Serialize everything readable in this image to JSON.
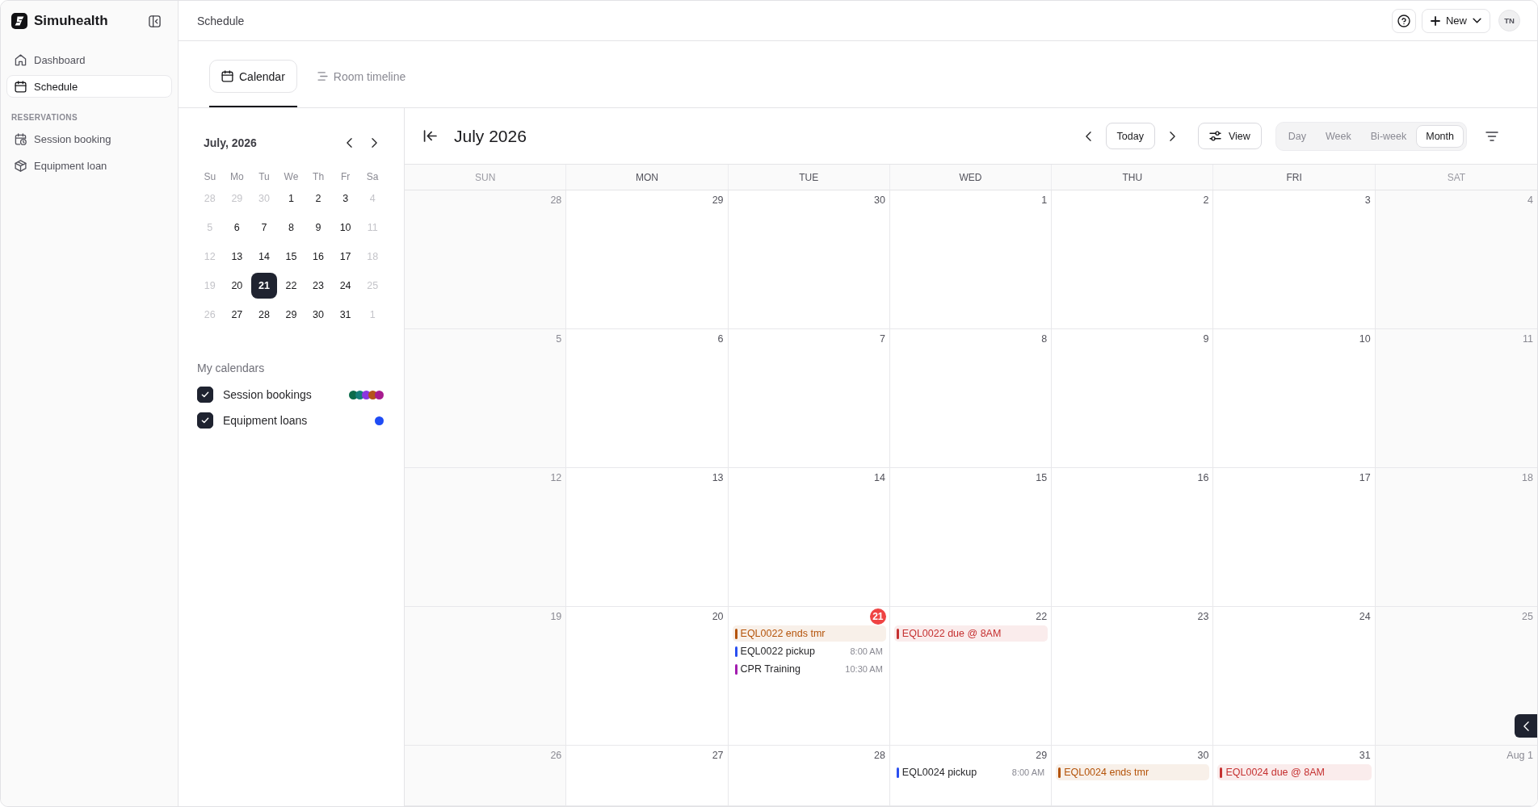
{
  "sidebar": {
    "brand": "Simuhealth",
    "nav": [
      {
        "label": "Dashboard",
        "selected": false
      },
      {
        "label": "Schedule",
        "selected": true
      }
    ],
    "section_label": "RESERVATIONS",
    "section_items": [
      {
        "label": "Session booking",
        "selected": false
      },
      {
        "label": "Equipment loan",
        "selected": false
      }
    ]
  },
  "topbar": {
    "title": "Schedule",
    "new_button": "New",
    "avatar": "TN"
  },
  "tabs": [
    {
      "label": "Calendar",
      "selected": true
    },
    {
      "label": "Room timeline",
      "selected": false
    }
  ],
  "mini_calendar": {
    "title": "July, 2026",
    "weekdays": [
      "Su",
      "Mo",
      "Tu",
      "We",
      "Th",
      "Fr",
      "Sa"
    ],
    "weeks": [
      [
        {
          "day": "28",
          "muted": true,
          "selected": false
        },
        {
          "day": "29",
          "muted": true,
          "selected": false
        },
        {
          "day": "30",
          "muted": true,
          "selected": false
        },
        {
          "day": "1",
          "muted": false,
          "selected": false
        },
        {
          "day": "2",
          "muted": false,
          "selected": false
        },
        {
          "day": "3",
          "muted": false,
          "selected": false
        },
        {
          "day": "4",
          "muted": true,
          "selected": false
        }
      ],
      [
        {
          "day": "5",
          "muted": true,
          "selected": false
        },
        {
          "day": "6",
          "muted": false,
          "selected": false
        },
        {
          "day": "7",
          "muted": false,
          "selected": false
        },
        {
          "day": "8",
          "muted": false,
          "selected": false
        },
        {
          "day": "9",
          "muted": false,
          "selected": false
        },
        {
          "day": "10",
          "muted": false,
          "selected": false
        },
        {
          "day": "11",
          "muted": true,
          "selected": false
        }
      ],
      [
        {
          "day": "12",
          "muted": true,
          "selected": false
        },
        {
          "day": "13",
          "muted": false,
          "selected": false
        },
        {
          "day": "14",
          "muted": false,
          "selected": false
        },
        {
          "day": "15",
          "muted": false,
          "selected": false
        },
        {
          "day": "16",
          "muted": false,
          "selected": false
        },
        {
          "day": "17",
          "muted": false,
          "selected": false
        },
        {
          "day": "18",
          "muted": true,
          "selected": false
        }
      ],
      [
        {
          "day": "19",
          "muted": true,
          "selected": false
        },
        {
          "day": "20",
          "muted": false,
          "selected": false
        },
        {
          "day": "21",
          "muted": false,
          "selected": true
        },
        {
          "day": "22",
          "muted": false,
          "selected": false
        },
        {
          "day": "23",
          "muted": false,
          "selected": false
        },
        {
          "day": "24",
          "muted": false,
          "selected": false
        },
        {
          "day": "25",
          "muted": true,
          "selected": false
        }
      ],
      [
        {
          "day": "26",
          "muted": true,
          "selected": false
        },
        {
          "day": "27",
          "muted": false,
          "selected": false
        },
        {
          "day": "28",
          "muted": false,
          "selected": false
        },
        {
          "day": "29",
          "muted": false,
          "selected": false
        },
        {
          "day": "30",
          "muted": false,
          "selected": false
        },
        {
          "day": "31",
          "muted": false,
          "selected": false
        },
        {
          "day": "1",
          "muted": true,
          "selected": false
        }
      ]
    ]
  },
  "my_calendars": {
    "title": "My calendars",
    "items": [
      {
        "label": "Session bookings",
        "checked": true,
        "dots": [
          {
            "color": "#0b6b4b"
          },
          {
            "color": "#137d78"
          },
          {
            "color": "#8b35e0"
          },
          {
            "color": "#b5531a"
          },
          {
            "color": "#a81b8f"
          }
        ]
      },
      {
        "label": "Equipment loans",
        "checked": true,
        "dots": [
          {
            "color": "#1f4cf5"
          }
        ]
      }
    ]
  },
  "calendar": {
    "title": "July 2026",
    "today_button": "Today",
    "view_button": "View",
    "view_modes": [
      {
        "label": "Day",
        "selected": false
      },
      {
        "label": "Week",
        "selected": false
      },
      {
        "label": "Bi-week",
        "selected": false
      },
      {
        "label": "Month",
        "selected": true
      }
    ],
    "weekdays": [
      {
        "label": "SUN",
        "weekend": true
      },
      {
        "label": "MON",
        "weekend": false
      },
      {
        "label": "TUE",
        "weekend": false
      },
      {
        "label": "WED",
        "weekend": false
      },
      {
        "label": "THU",
        "weekend": false
      },
      {
        "label": "FRI",
        "weekend": false
      },
      {
        "label": "SAT",
        "weekend": true
      }
    ],
    "weeks": [
      [
        {
          "day": "28",
          "today": false
        },
        {
          "day": "29",
          "today": false
        },
        {
          "day": "30",
          "today": false
        },
        {
          "day": "1",
          "today": false
        },
        {
          "day": "2",
          "today": false
        },
        {
          "day": "3",
          "today": false
        },
        {
          "day": "4",
          "today": false
        }
      ],
      [
        {
          "day": "5",
          "today": false
        },
        {
          "day": "6",
          "today": false
        },
        {
          "day": "7",
          "today": false
        },
        {
          "day": "8",
          "today": false
        },
        {
          "day": "9",
          "today": false
        },
        {
          "day": "10",
          "today": false
        },
        {
          "day": "11",
          "today": false
        }
      ],
      [
        {
          "day": "12",
          "today": false
        },
        {
          "day": "13",
          "today": false
        },
        {
          "day": "14",
          "today": false
        },
        {
          "day": "15",
          "today": false
        },
        {
          "day": "16",
          "today": false
        },
        {
          "day": "17",
          "today": false
        },
        {
          "day": "18",
          "today": false
        }
      ],
      [
        {
          "day": "19",
          "today": false
        },
        {
          "day": "20",
          "today": false
        },
        {
          "day": "21",
          "today": true,
          "events": [
            {
              "kind": "banner",
              "title": "EQL0022 ends tmr",
              "color": "#b45309"
            },
            {
              "kind": "timed",
              "title": "EQL0022 pickup",
              "time": "8:00 AM",
              "color": "#2a4ff0"
            },
            {
              "kind": "timed",
              "title": "CPR Training",
              "time": "10:30 AM",
              "color": "#a21caf"
            }
          ]
        },
        {
          "day": "22",
          "today": false,
          "events": [
            {
              "kind": "banner",
              "title": "EQL0022 due @ 8AM",
              "color": "#c53030"
            }
          ]
        },
        {
          "day": "23",
          "today": false
        },
        {
          "day": "24",
          "today": false
        },
        {
          "day": "25",
          "today": false
        }
      ],
      [
        {
          "day": "26",
          "today": false
        },
        {
          "day": "27",
          "today": false
        },
        {
          "day": "28",
          "today": false
        },
        {
          "day": "29",
          "today": false,
          "events": [
            {
              "kind": "timed",
              "title": "EQL0024 pickup",
              "time": "8:00 AM",
              "color": "#2a4ff0"
            }
          ]
        },
        {
          "day": "30",
          "today": false,
          "events": [
            {
              "kind": "banner",
              "title": "EQL0024 ends tmr",
              "color": "#b45309"
            }
          ]
        },
        {
          "day": "31",
          "today": false,
          "events": [
            {
              "kind": "banner",
              "title": "EQL0024 due @ 8AM",
              "color": "#c53030"
            }
          ]
        },
        {
          "day": "Aug 1",
          "today": false
        }
      ]
    ]
  }
}
